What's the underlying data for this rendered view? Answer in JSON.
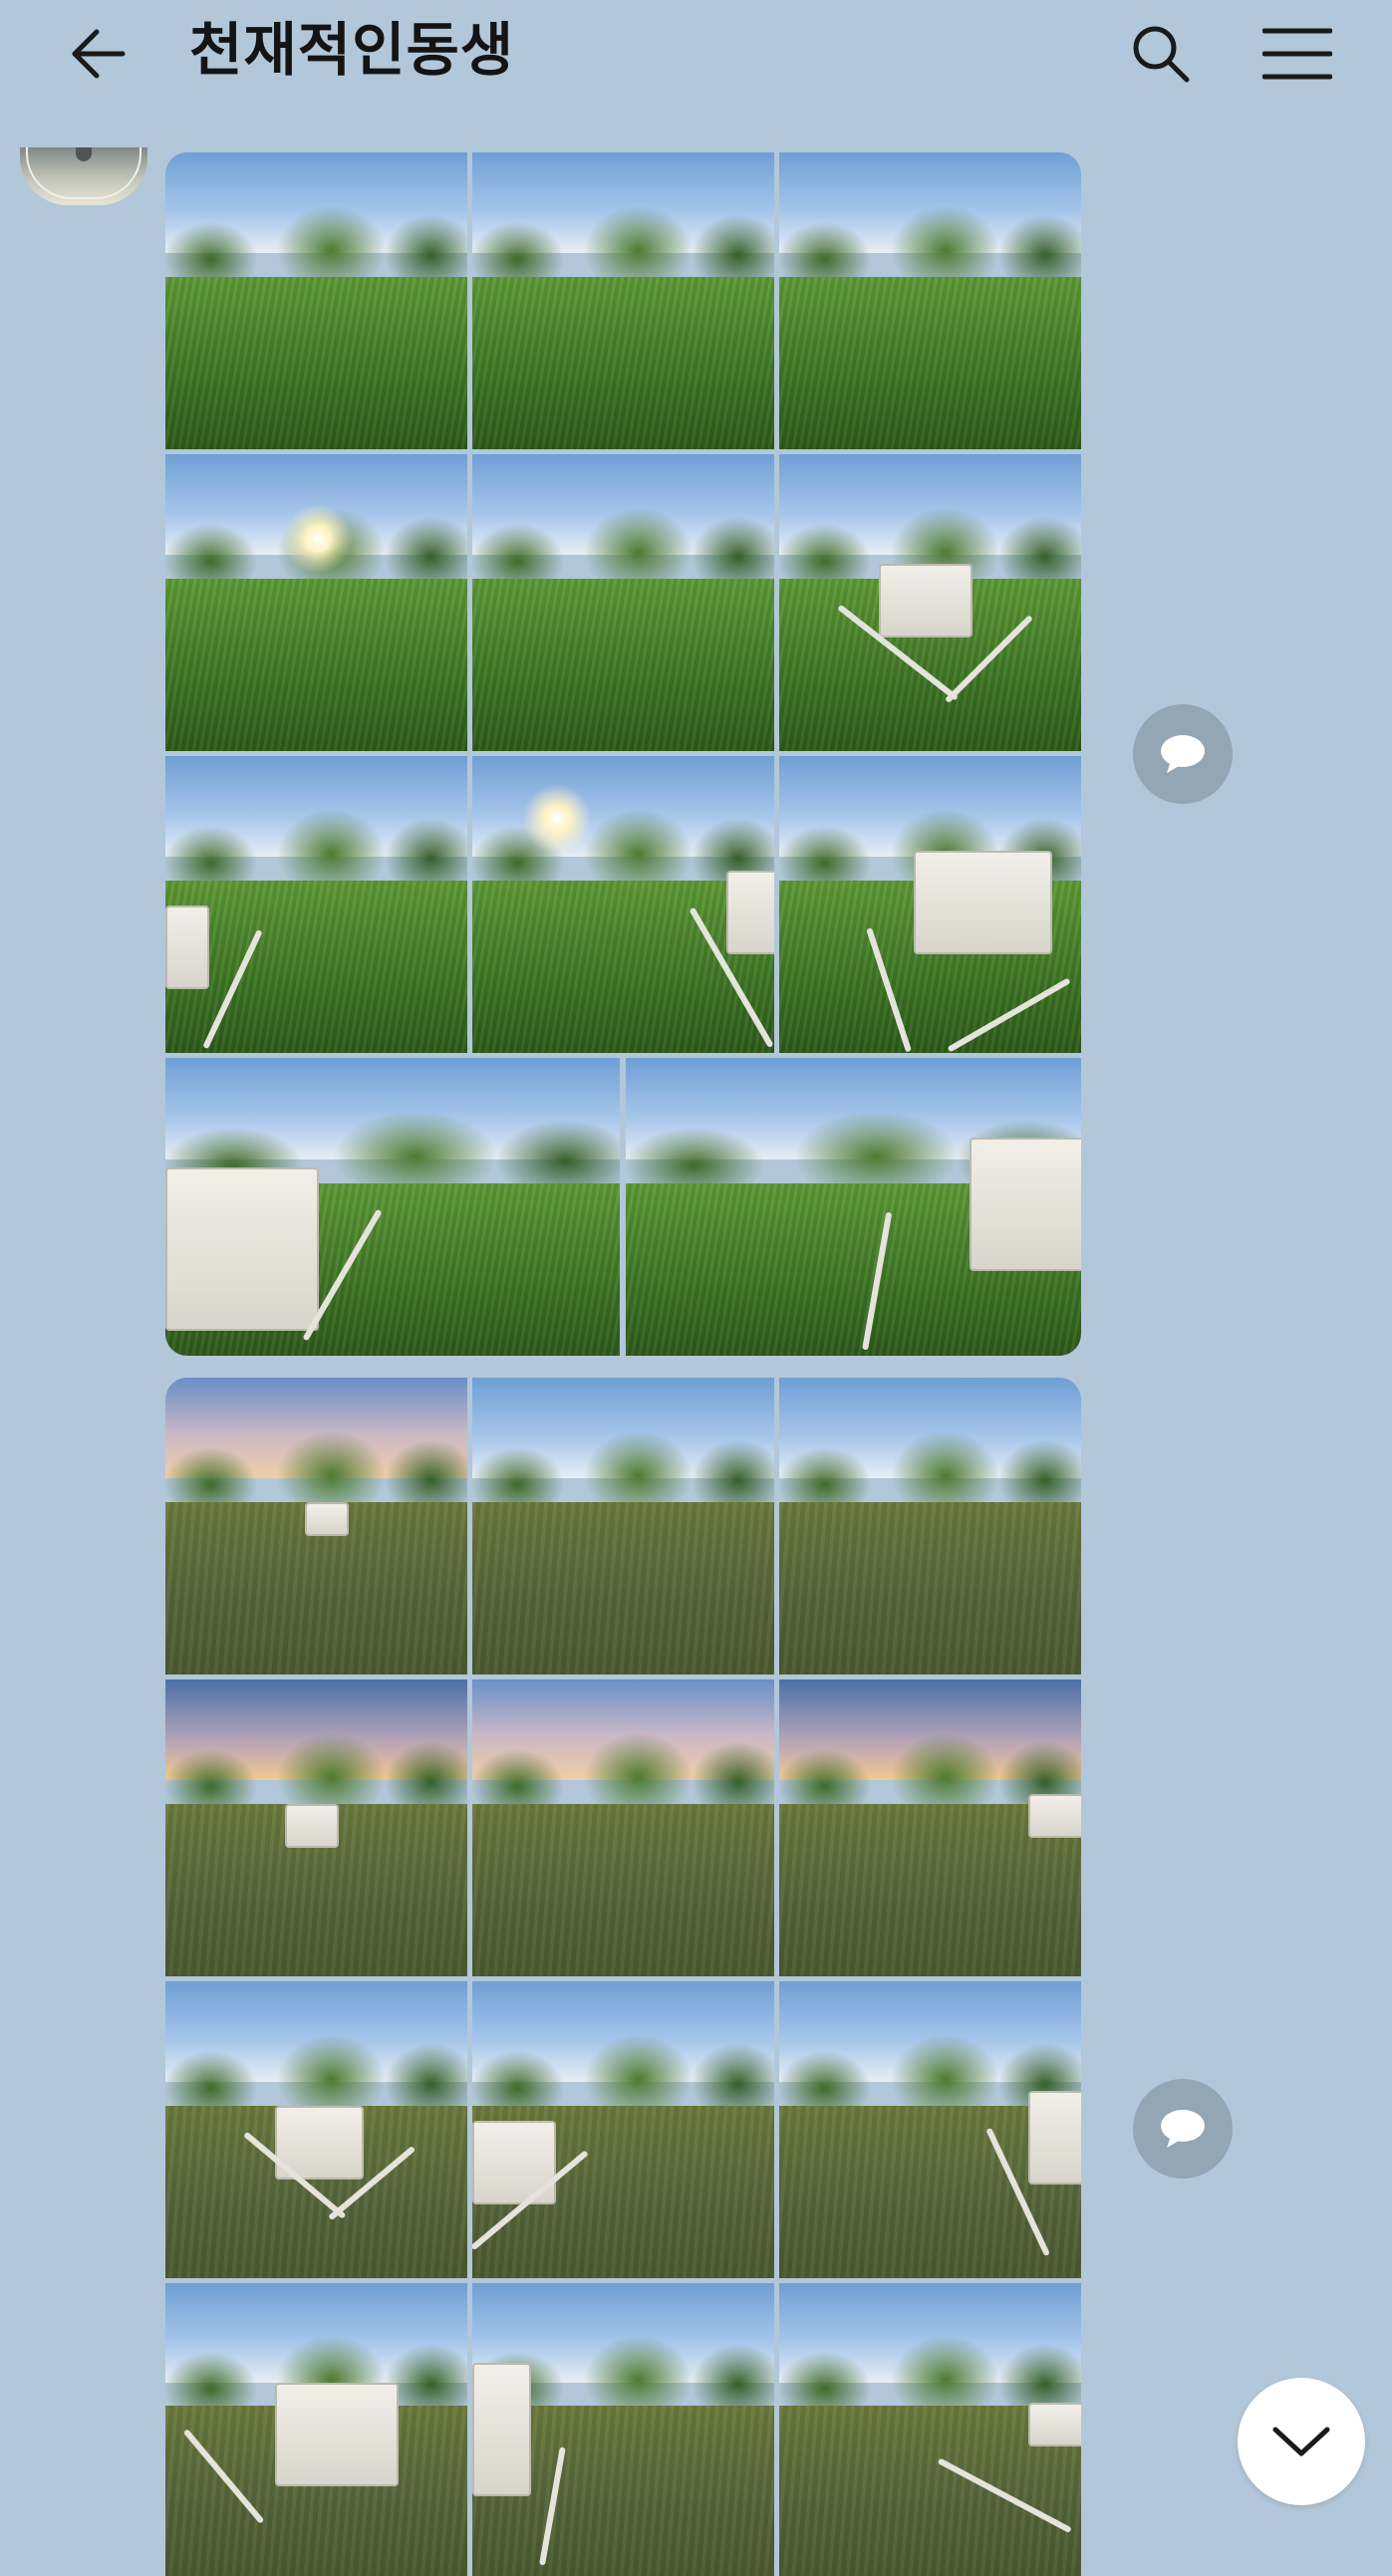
{
  "header": {
    "title": "천재적인동생",
    "back_icon": "arrow-left-icon",
    "search_icon": "search-icon",
    "menu_icon": "hamburger-menu-icon"
  },
  "messages": [
    {
      "sender_avatar": "avatar",
      "album": {
        "photo_count": 11,
        "rows": [
          3,
          3,
          3,
          2
        ]
      },
      "action_icon": "chat-bubble-icon"
    },
    {
      "album": {
        "photo_count": 12,
        "rows": [
          3,
          3,
          3,
          3
        ]
      },
      "action_icon": "chat-bubble-icon"
    }
  ],
  "scroll_down_icon": "chevron-down-icon",
  "colors": {
    "background": "#b2c7d9",
    "title_text": "#141414",
    "icon_dark": "#1a1a1a",
    "chat_icon_bg": "#94a5b4",
    "scroll_button_bg": "#ffffff"
  }
}
